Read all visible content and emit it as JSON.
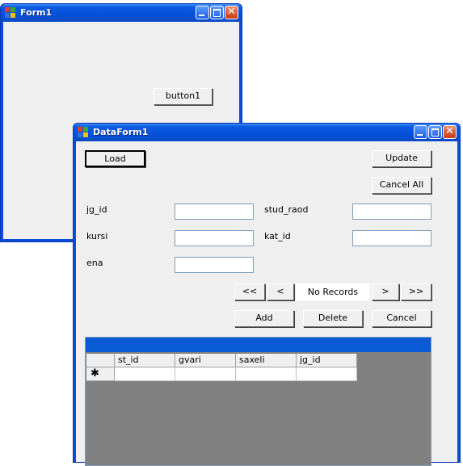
{
  "form1": {
    "title": "Form1",
    "button_label": "button1"
  },
  "dataform": {
    "title": "DataForm1",
    "load_label": "Load",
    "update_label": "Update",
    "cancel_all_label": "Cancel All",
    "fields": {
      "jg_id": {
        "label": "jg_id",
        "value": ""
      },
      "stud_raod": {
        "label": "stud_raod",
        "value": ""
      },
      "kursi": {
        "label": "kursi",
        "value": ""
      },
      "kat_id": {
        "label": "kat_id",
        "value": ""
      },
      "ena": {
        "label": "ena",
        "value": ""
      }
    },
    "nav": {
      "first": "<<",
      "prev": "<",
      "status": "No Records",
      "next": ">",
      "last": ">>"
    },
    "add_label": "Add",
    "delete_label": "Delete",
    "cancel_label": "Cancel",
    "grid": {
      "columns": [
        "st_id",
        "gvari",
        "saxeli",
        "jg_id"
      ],
      "new_row_marker": "✱"
    }
  },
  "colors": {
    "titlebar": "#0552d8",
    "client": "#efefef",
    "grid_background": "#808080",
    "grid_caption": "#0a5ad6"
  }
}
